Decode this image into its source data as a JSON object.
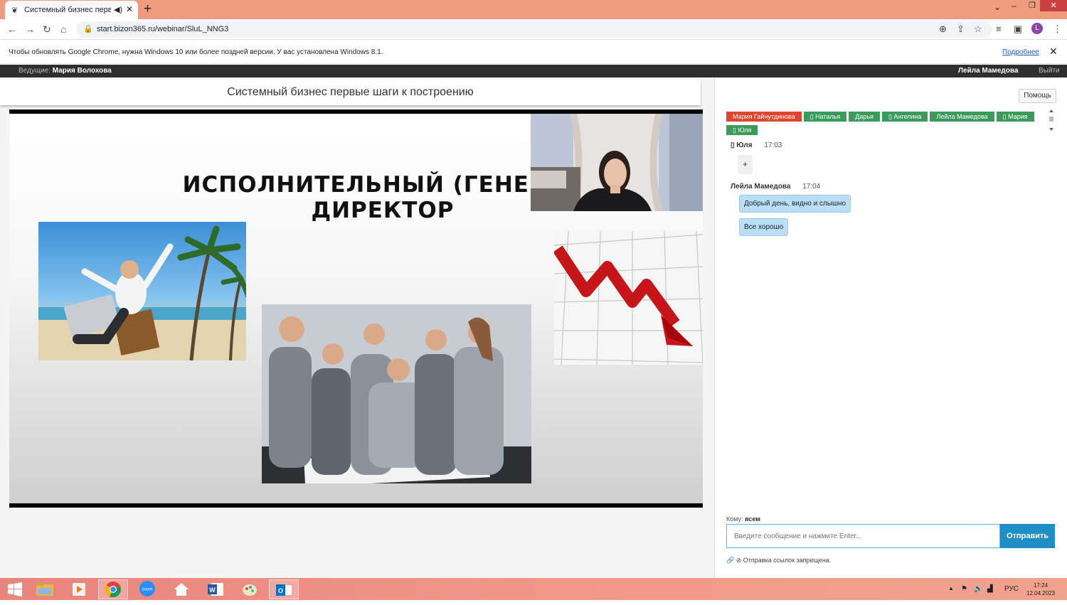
{
  "browser": {
    "tab_title": "Системный бизнес первые",
    "new_tab": "+",
    "url": "start.bizon365.ru/webinar/SluL_NNG3",
    "infobar_message": "Чтобы обновлять Google Chrome, нужна Windows 10 или более поздней версии. У вас установлена Windows 8.1.",
    "infobar_link": "Подробнее",
    "profile_initial": "L"
  },
  "webinar": {
    "host_label": "Ведущие:",
    "host_name": "Мария Волохова",
    "current_user": "Лейла Мамедова",
    "exit_label": "Выйти",
    "title": "Системный бизнес первые шаги к построению",
    "slide_title": "ИСПОЛНИТЕЛЬНЫЙ (ГЕНЕРАЛЬНЫЙ) ДИРЕКТОР",
    "slide_line1": "ИСПОЛНИТЕЛЬНЫЙ (ГЕНЕРАЛ",
    "slide_line2": "ДИРЕКТОР"
  },
  "chat": {
    "help_label": "Помощь",
    "participants": [
      "Мария Гайнутдинова",
      "▯ Наталья",
      "Дарья",
      "▯ Ангелина",
      "Лейла Мамедова",
      "▯ Мария",
      "▯ Юля"
    ],
    "messages": [
      {
        "author": "▯ Юля",
        "time": "17:03",
        "text": "+"
      },
      {
        "author": "Лейла Мамедова",
        "time": "17:04",
        "text": "Добрый день, видно и слышно"
      },
      {
        "author": "",
        "time": "",
        "text": "Все хорошо"
      }
    ],
    "recipient_label": "Кому:",
    "recipient_value": "всем",
    "input_placeholder": "Введите сообщение и нажмите Enter...",
    "send_label": "Отправить",
    "links_notice": "Отправка ссылок запрещена."
  },
  "taskbar": {
    "lang": "РУС",
    "time": "17:24",
    "date": "12.04.2023",
    "zoom_label": "zoom"
  },
  "colors": {
    "tabbar": "#ee9c7d",
    "send_button": "#1f8ec7",
    "chip_green": "#3a9b5b",
    "chip_red": "#e0452e"
  }
}
